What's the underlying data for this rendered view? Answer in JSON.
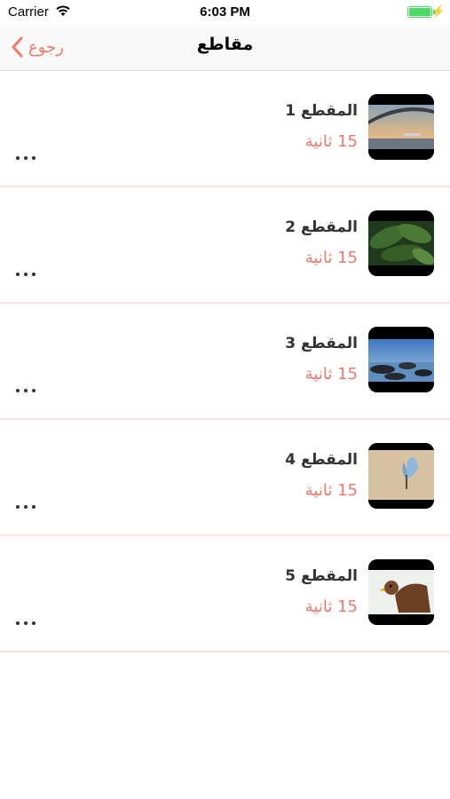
{
  "status_bar": {
    "carrier": "Carrier",
    "time": "6:03 PM",
    "icons": [
      "wifi-icon",
      "battery-icon",
      "charging-bolt-icon"
    ]
  },
  "nav": {
    "back_label": "رجوع",
    "title": "مقاطع",
    "back_icon": "chevron-left-icon"
  },
  "colors": {
    "accent": "#ee7a6f",
    "separator": "#fbe1df"
  },
  "clips": [
    {
      "name": "المقطع 1",
      "duration": "15 ثانية",
      "thumbnail": "bridge-sunset"
    },
    {
      "name": "المقطع 2",
      "duration": "15 ثانية",
      "thumbnail": "green-leaves"
    },
    {
      "name": "المقطع 3",
      "duration": "15 ثانية",
      "thumbnail": "rocky-seashore"
    },
    {
      "name": "المقطع 4",
      "duration": "15 ثانية",
      "thumbnail": "blue-butterfly"
    },
    {
      "name": "المقطع 5",
      "duration": "15 ثانية",
      "thumbnail": "eagle"
    }
  ]
}
